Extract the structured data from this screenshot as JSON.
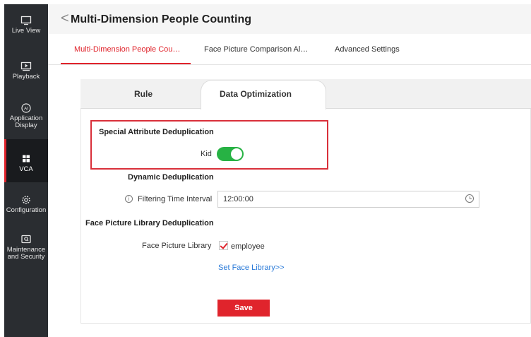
{
  "sidebar": {
    "items": [
      {
        "label": "Live View",
        "icon": "monitor-icon"
      },
      {
        "label": "Playback",
        "icon": "playback-icon"
      },
      {
        "label": "Application Display",
        "icon": "ai-icon"
      },
      {
        "label": "VCA",
        "icon": "grid-icon"
      },
      {
        "label": "Configuration",
        "icon": "gear-icon"
      },
      {
        "label": "Maintenance and Security",
        "icon": "maintenance-icon"
      }
    ]
  },
  "header": {
    "back": "<",
    "title": "Multi-Dimension People Counting"
  },
  "tabs": [
    {
      "label": "Multi-Dimension People Cou…"
    },
    {
      "label": "Face Picture Comparison Al…"
    },
    {
      "label": "Advanced Settings"
    }
  ],
  "subtabs": [
    {
      "label": "Rule"
    },
    {
      "label": "Data Optimization"
    }
  ],
  "form": {
    "special_attr_heading": "Special Attribute Deduplication",
    "kid_label": "Kid",
    "dynamic_heading": "Dynamic Deduplication",
    "interval_label": "Filtering Time Interval",
    "interval_value": "12:00:00",
    "face_lib_heading": "Face Picture Library Deduplication",
    "face_lib_label": "Face Picture Library",
    "employee_label": "employee",
    "set_library_link": "Set Face Library>>",
    "save_label": "Save"
  },
  "colors": {
    "accent": "#e0242c",
    "toggle_on": "#27b244",
    "link": "#2a7ad8",
    "sidebar_bg": "#2a2d31"
  }
}
